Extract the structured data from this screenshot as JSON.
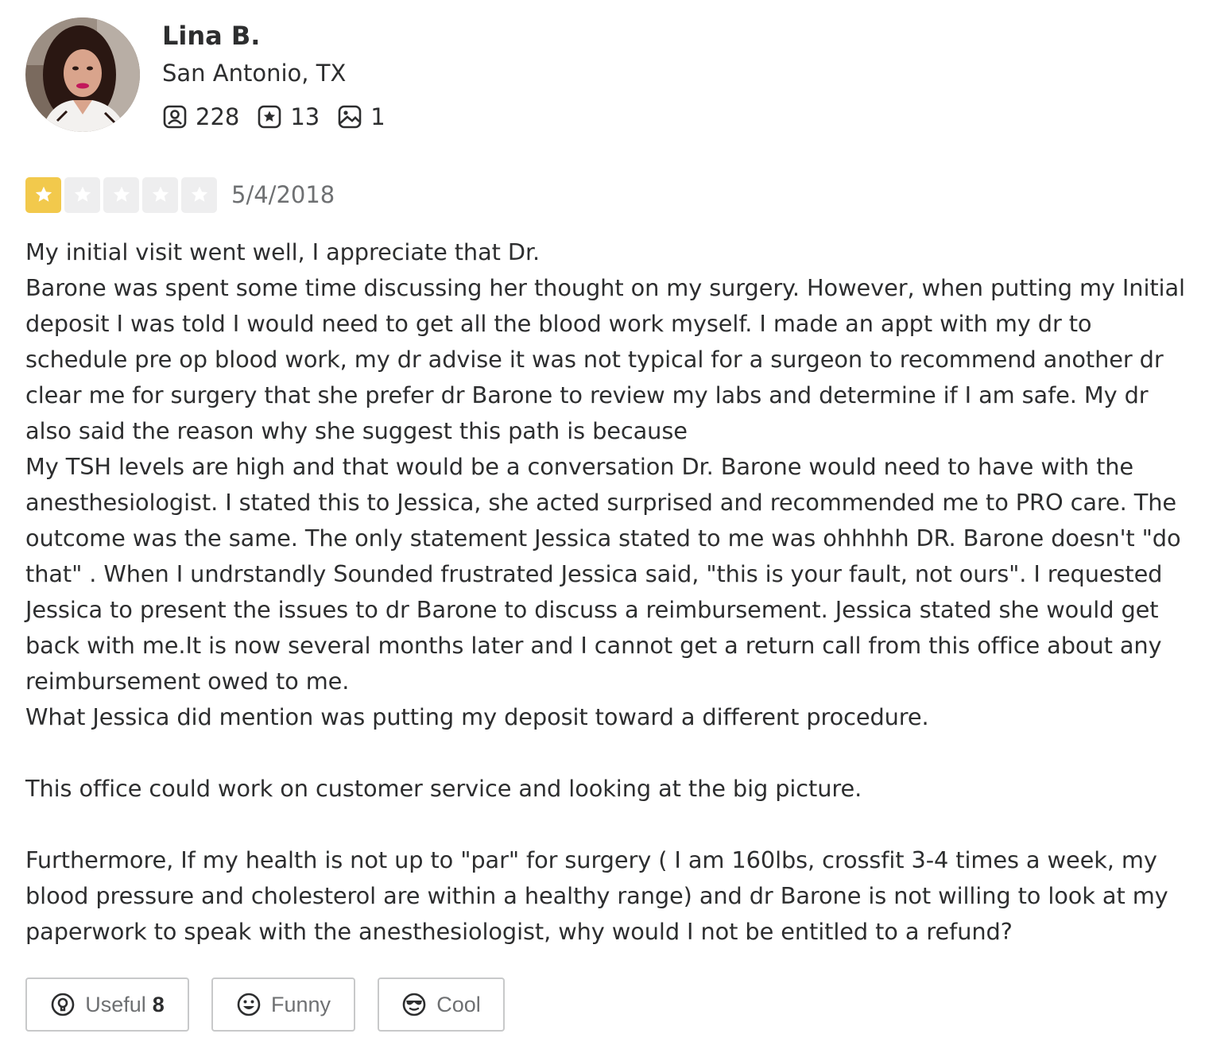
{
  "user": {
    "name": "Lina B.",
    "location": "San Antonio, TX",
    "avatar_icon": "user-photo",
    "stats": {
      "friends": "228",
      "reviews": "13",
      "photos": "1"
    }
  },
  "review": {
    "rating": 1,
    "rating_max": 5,
    "date": "5/4/2018",
    "text": "My initial visit went well, I appreciate that Dr.\nBarone was spent some time discussing her thought on my surgery. However, when putting my Initial deposit I was told I would need to get all the blood work myself. I made an appt with my dr to schedule pre op blood work, my dr advise it was not typical for a surgeon to recommend another dr clear me for surgery that she prefer dr Barone to review my labs and determine if I am safe. My dr also said the reason why she suggest this path is because\nMy TSH levels are high and that would be a conversation Dr. Barone would need to have with the anesthesiologist. I stated this to Jessica, she acted surprised and recommended me to PRO care. The outcome was the same. The only statement Jessica stated to me was ohhhhh DR. Barone doesn't \"do that\" . When I undrstandly Sounded frustrated Jessica said, \"this is your fault, not ours\". I requested Jessica to present the issues to dr Barone to discuss a reimbursement. Jessica stated she would get back with me.It is now several months later and I cannot get a return call from this office about any reimbursement owed to me.\nWhat Jessica did mention was putting my deposit toward a different procedure.\n\nThis office could work on customer service and looking at the big picture.\n\nFurthermore, If my health is not up to \"par\" for surgery ( I am 160lbs, crossfit 3-4 times a week, my blood pressure and cholesterol are within a healthy range) and dr Barone is not willing to look at my paperwork to speak with the anesthesiologist, why would I not be entitled to a refund?"
  },
  "reactions": {
    "useful_label": "Useful",
    "useful_count": "8",
    "funny_label": "Funny",
    "cool_label": "Cool"
  },
  "colors": {
    "star_filled": "#f2c94c",
    "star_empty": "#eeeeef",
    "text": "#2d2e2f",
    "muted": "#6e7072"
  }
}
